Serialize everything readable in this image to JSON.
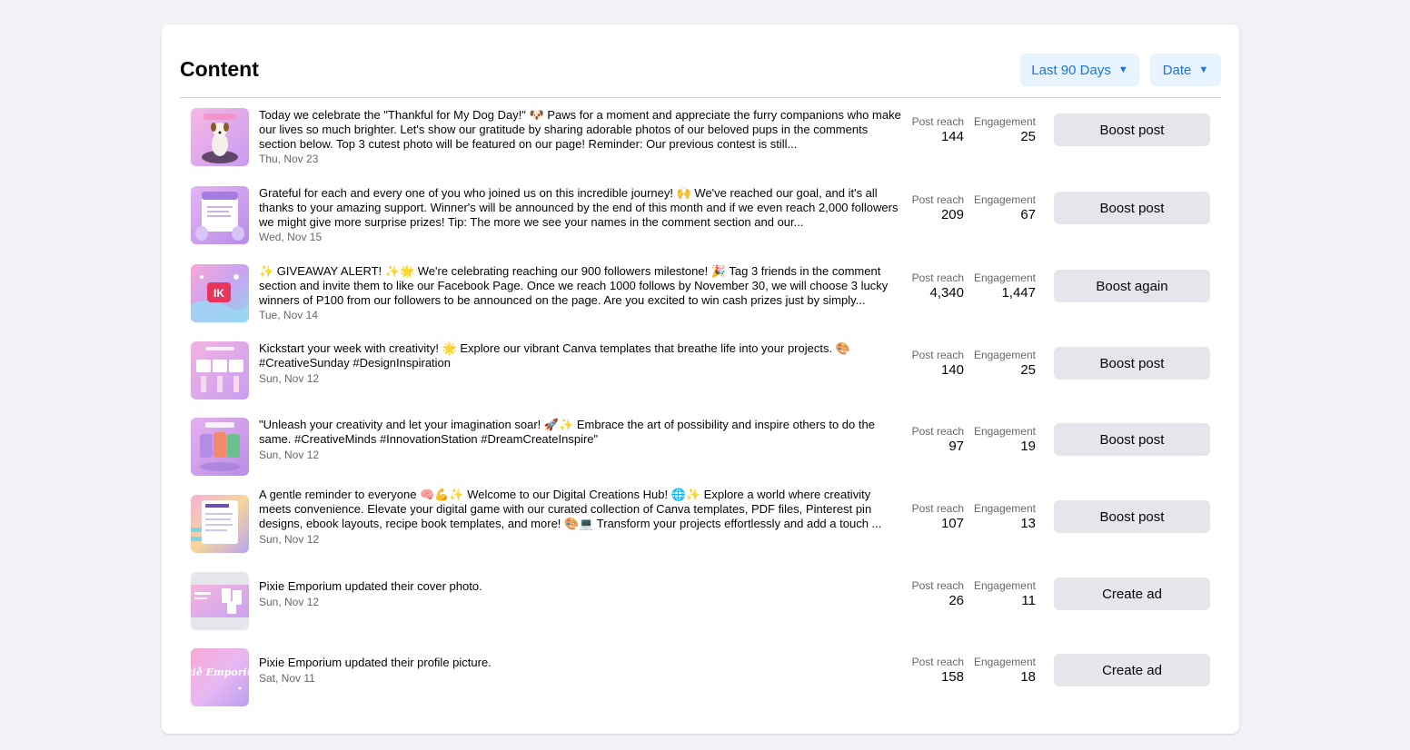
{
  "header": {
    "title": "Content",
    "range_filter": "Last 90 Days",
    "sort_filter": "Date"
  },
  "metric_labels": {
    "reach": "Post reach",
    "engagement": "Engagement"
  },
  "posts": [
    {
      "text": "Today we celebrate the \"Thankful for My Dog Day!\" 🐶 Paws for a moment and appreciate the furry companions who make our lives so much brighter. Let's show our gratitude by sharing adorable photos of our beloved pups in the comments section below. Top 3 cutest photo will be featured on our page! Reminder: Our previous contest is still...",
      "date": "Thu, Nov 23",
      "reach": "144",
      "engagement": "25",
      "action": "Boost post",
      "thumb_icon": "dog-photo-icon"
    },
    {
      "text": "Grateful for each and every one of you who joined us on this incredible journey! 🙌 We've reached our goal, and it's all thanks to your amazing support. Winner's will be announced by the end of this month and if we even reach 2,000 followers we might give more surprise prizes! Tip: The more we see your names in the comment section and our...",
      "date": "Wed, Nov 15",
      "reach": "209",
      "engagement": "67",
      "action": "Boost post",
      "thumb_icon": "hello-poster-icon"
    },
    {
      "text": "✨ GIVEAWAY ALERT! ✨🌟 We're celebrating reaching our 900 followers milestone! 🎉 Tag 3 friends in the comment section and invite them to like our Facebook Page. Once we reach 1000 follows by November 30, we will choose 3 lucky winners of P100 from our followers to be announced on the page. Are you excited to win cash prizes just by simply...",
      "date": "Tue, Nov 14",
      "reach": "4,340",
      "engagement": "1,447",
      "action": "Boost again",
      "thumb_icon": "giveaway-graphic-icon"
    },
    {
      "text": "Kickstart your week with creativity! 🌟 Explore our vibrant Canva templates that breathe life into your projects. 🎨 #CreativeSunday #DesignInspiration",
      "date": "Sun, Nov 12",
      "reach": "140",
      "engagement": "25",
      "action": "Boost post",
      "thumb_icon": "templates-showcase-icon"
    },
    {
      "text": "\"Unleash your creativity and let your imagination soar! 🚀✨ Embrace the art of possibility and inspire others to do the same. #CreativeMinds #InnovationStation #DreamCreateInspire\"",
      "date": "Sun, Nov 12",
      "reach": "97",
      "engagement": "19",
      "action": "Boost post",
      "thumb_icon": "product-cards-icon"
    },
    {
      "text": "A gentle reminder to everyone 🧠💪✨ Welcome to our Digital Creations Hub! 🌐✨ Explore a world where creativity meets convenience. Elevate your digital game with our curated collection of Canva templates, PDF files, Pinterest pin designs, ebook layouts, recipe book templates, and more! 🎨💻 Transform your projects effortlessly and add a touch ...",
      "date": "Sun, Nov 12",
      "reach": "107",
      "engagement": "13",
      "action": "Boost post",
      "thumb_icon": "reminder-note-icon"
    },
    {
      "text": "Pixie Emporium updated their cover photo.",
      "date": "Sun, Nov 12",
      "reach": "26",
      "engagement": "11",
      "action": "Create ad",
      "thumb_icon": "cover-photo-icon"
    },
    {
      "text": "Pixie Emporium updated their profile picture.",
      "date": "Sat, Nov 11",
      "reach": "158",
      "engagement": "18",
      "action": "Create ad",
      "thumb_icon": "profile-logo-icon",
      "thumb_logo_text": "Pixie Emporium"
    }
  ]
}
